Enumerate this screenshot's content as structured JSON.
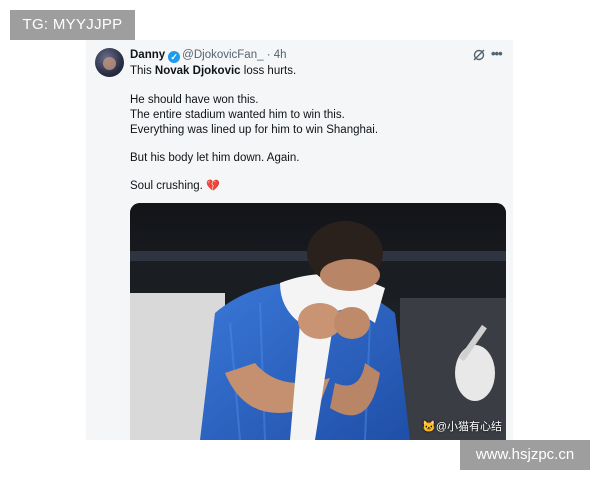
{
  "watermarks": {
    "top_left": "TG: MYYJJPP",
    "bottom_right": "www.hsjzpc.cn"
  },
  "tweet": {
    "author_name": "Danny",
    "handle": "@DjokovicFan_",
    "time": "· 4h",
    "line1_pre": "This ",
    "line1_bold": "Novak Djokovic",
    "line1_post": " loss hurts.",
    "line2": "He should have won this.",
    "line3": "The entire stadium wanted him to win this.",
    "line4": "Everything was lined up for him to win Shanghai.",
    "line5": "But his body let him down. Again.",
    "line6": "Soul crushing.",
    "emoji": "💔",
    "media_watermark": "🐱@小猫有心结",
    "icons": {
      "verified": "verified-badge-icon",
      "grok": "grok-icon",
      "more": "more-icon"
    }
  },
  "colors": {
    "verified": "#1d9bf0",
    "handle": "#536471",
    "shirt": "#2f66c9"
  }
}
